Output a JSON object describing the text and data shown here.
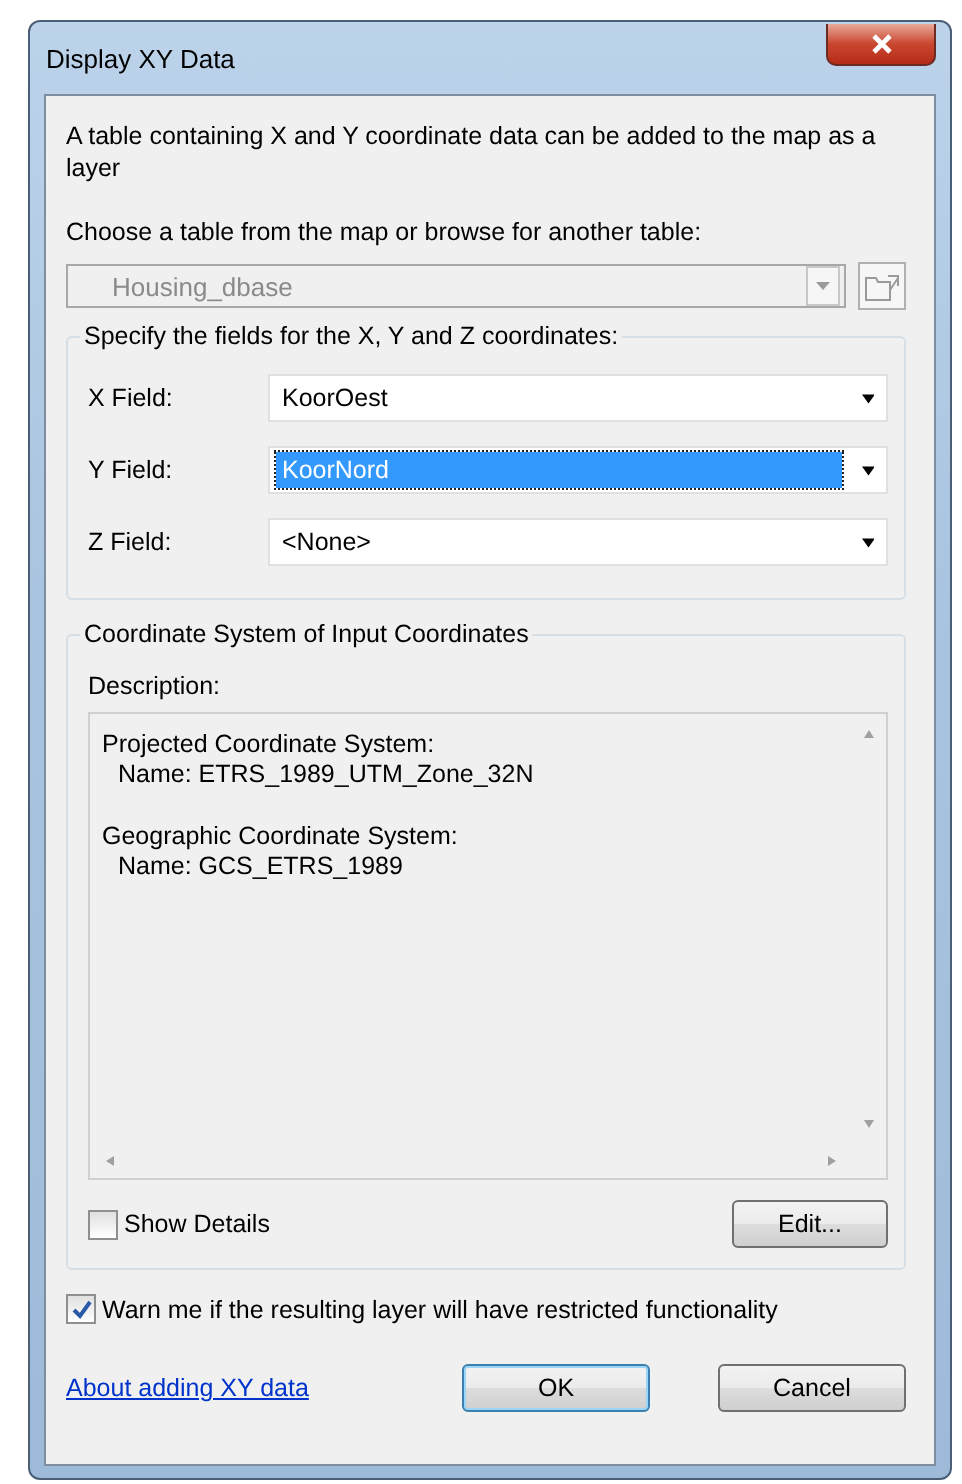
{
  "window": {
    "title": "Display XY Data"
  },
  "intro": "A table containing X and Y coordinate data can be added to the map as a layer",
  "table_prompt": "Choose a table from the map or browse for another table:",
  "table_select": {
    "value": "Housing_dbase",
    "disabled": true
  },
  "fields_group": {
    "title": "Specify the fields for the X, Y and Z coordinates:",
    "fields": [
      {
        "label": "X Field:",
        "value": "KoorOest",
        "selected": false
      },
      {
        "label": "Y Field:",
        "value": "KoorNord",
        "selected": true
      },
      {
        "label": "Z Field:",
        "value": "<None>",
        "selected": false
      }
    ]
  },
  "coordinate_group": {
    "title": "Coordinate System of Input Coordinates",
    "description_label": "Description:",
    "description": [
      {
        "kind": "heading",
        "text": "Projected Coordinate System:"
      },
      {
        "kind": "detail",
        "text": "Name: ETRS_1989_UTM_Zone_32N"
      },
      {
        "kind": "heading",
        "text": "Geographic Coordinate System:"
      },
      {
        "kind": "detail",
        "text": "Name: GCS_ETRS_1989"
      }
    ],
    "show_details": {
      "label": "Show Details",
      "checked": false
    },
    "edit_button": "Edit..."
  },
  "warn": {
    "label": "Warn me if the resulting layer will have restricted functionality",
    "checked": true
  },
  "help_link": "About adding XY data",
  "buttons": [
    {
      "label": "OK",
      "default": true
    },
    {
      "label": "Cancel",
      "default": false
    }
  ]
}
